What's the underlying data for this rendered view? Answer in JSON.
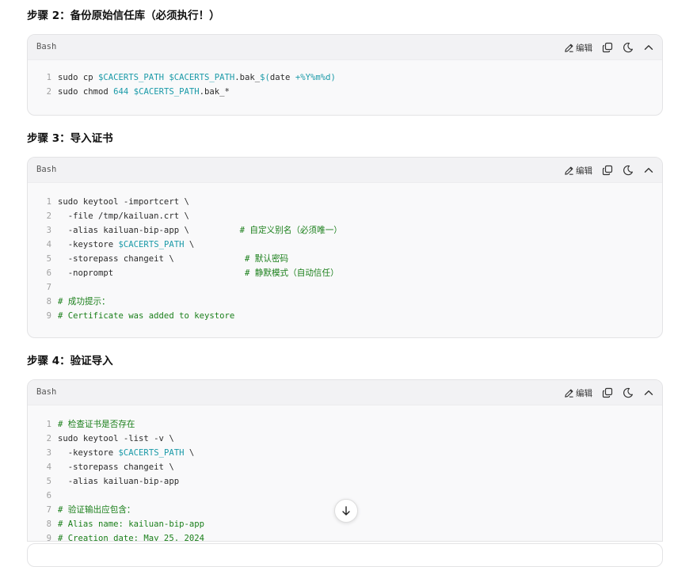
{
  "step2": {
    "title": "步骤 2：备份原始信任库（必须执行！）",
    "lang": "Bash",
    "edit_label": "编辑",
    "lines": [
      {
        "n": "1",
        "parts": [
          {
            "t": "sudo cp ",
            "c": ""
          },
          {
            "t": "$CACERTS_PATH",
            "c": "var"
          },
          {
            "t": " ",
            "c": ""
          },
          {
            "t": "$CACERTS_PATH",
            "c": "var"
          },
          {
            "t": ".bak_",
            "c": ""
          },
          {
            "t": "$(",
            "c": "var"
          },
          {
            "t": "date ",
            "c": ""
          },
          {
            "t": "+%Y%m%d",
            "c": "var"
          },
          {
            "t": ")",
            "c": "var"
          }
        ]
      },
      {
        "n": "2",
        "parts": [
          {
            "t": "sudo chmod ",
            "c": ""
          },
          {
            "t": "644",
            "c": "num"
          },
          {
            "t": " ",
            "c": ""
          },
          {
            "t": "$CACERTS_PATH",
            "c": "var"
          },
          {
            "t": ".bak_*",
            "c": ""
          }
        ]
      }
    ]
  },
  "step3": {
    "title": "步骤 3：导入证书",
    "lang": "Bash",
    "edit_label": "编辑",
    "lines": [
      {
        "n": "1",
        "parts": [
          {
            "t": "sudo keytool -importcert \\",
            "c": ""
          }
        ]
      },
      {
        "n": "2",
        "parts": [
          {
            "t": "  -file /tmp/kailuan.crt \\",
            "c": ""
          }
        ]
      },
      {
        "n": "3",
        "parts": [
          {
            "t": "  -alias kailuan-bip-app \\          ",
            "c": ""
          },
          {
            "t": "# 自定义别名（必须唯一）",
            "c": "cmt"
          }
        ]
      },
      {
        "n": "4",
        "parts": [
          {
            "t": "  -keystore ",
            "c": ""
          },
          {
            "t": "$CACERTS_PATH",
            "c": "var"
          },
          {
            "t": " \\",
            "c": ""
          }
        ]
      },
      {
        "n": "5",
        "parts": [
          {
            "t": "  -storepass changeit \\              ",
            "c": ""
          },
          {
            "t": "# 默认密码",
            "c": "cmt"
          }
        ]
      },
      {
        "n": "6",
        "parts": [
          {
            "t": "  -noprompt                          ",
            "c": ""
          },
          {
            "t": "# 静默模式（自动信任）",
            "c": "cmt"
          }
        ]
      },
      {
        "n": "7",
        "parts": []
      },
      {
        "n": "8",
        "parts": [
          {
            "t": "# 成功提示：",
            "c": "cmt"
          }
        ]
      },
      {
        "n": "9",
        "parts": [
          {
            "t": "# Certificate was added to keystore",
            "c": "cmt"
          }
        ]
      }
    ]
  },
  "step4": {
    "title": "步骤 4：验证导入",
    "lang": "Bash",
    "edit_label": "编辑",
    "lines": [
      {
        "n": "1",
        "parts": [
          {
            "t": "# 检查证书是否存在",
            "c": "cmt"
          }
        ]
      },
      {
        "n": "2",
        "parts": [
          {
            "t": "sudo keytool -list -v \\",
            "c": ""
          }
        ]
      },
      {
        "n": "3",
        "parts": [
          {
            "t": "  -keystore ",
            "c": ""
          },
          {
            "t": "$CACERTS_PATH",
            "c": "var"
          },
          {
            "t": " \\",
            "c": ""
          }
        ]
      },
      {
        "n": "4",
        "parts": [
          {
            "t": "  -storepass changeit \\",
            "c": ""
          }
        ]
      },
      {
        "n": "5",
        "parts": [
          {
            "t": "  -alias kailuan-bip-app",
            "c": ""
          }
        ]
      },
      {
        "n": "6",
        "parts": []
      },
      {
        "n": "7",
        "parts": [
          {
            "t": "# 验证输出应包含：",
            "c": "cmt"
          }
        ]
      },
      {
        "n": "8",
        "parts": [
          {
            "t": "# Alias name: kailuan-bip-app",
            "c": "cmt"
          }
        ]
      },
      {
        "n": "9",
        "parts": [
          {
            "t": "# Creation date: May 25, 2024",
            "c": "cmt"
          }
        ]
      }
    ]
  },
  "icons": [
    "edit-icon",
    "copy-icon",
    "theme-moon-icon",
    "collapse-chevron-up-icon",
    "scroll-down-arrow-icon"
  ]
}
